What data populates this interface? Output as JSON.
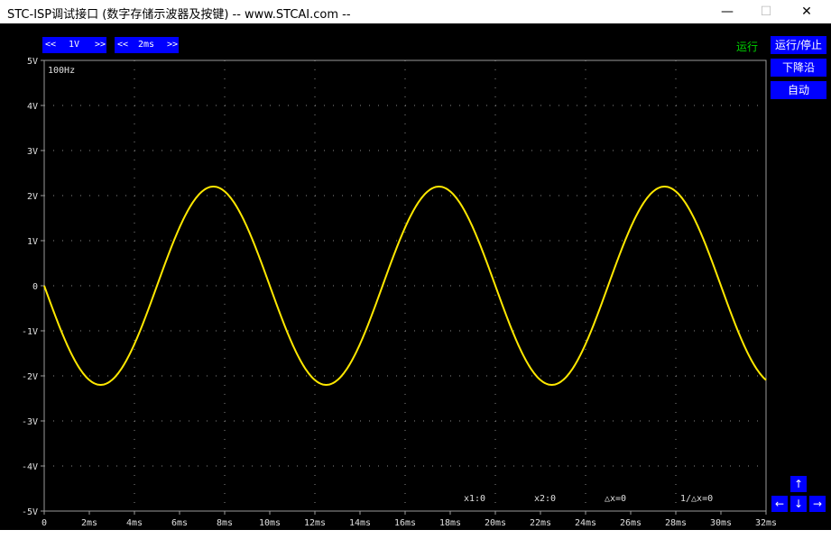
{
  "window": {
    "title": "STC-ISP调试接口 (数字存储示波器及按键) -- www.STCAI.com --",
    "minimize_icon": "—",
    "maximize_icon": "☐",
    "close_icon": "✕"
  },
  "toolbar": {
    "volt_prev": "<<",
    "volt_value": "1V",
    "volt_next": ">>",
    "time_prev": "<<",
    "time_value": "2ms",
    "time_next": ">>"
  },
  "status_text": "运行",
  "side_buttons": {
    "run_stop": "运行/停止",
    "trigger_edge": "下降沿",
    "auto": "自动"
  },
  "arrows": {
    "up": "↑",
    "down": "↓",
    "left": "←",
    "right": "→"
  },
  "frequency_label": "100Hz",
  "cursors": {
    "x1": "x1:0",
    "x2": "x2:0",
    "dx": "△x=0",
    "inv_dx": "1/△x=0"
  },
  "colors": {
    "trace": "#ffe800",
    "button_bg": "#0000ff",
    "status": "#00d400",
    "grid": "#8a8a8a",
    "frame": "#9a9a9a"
  },
  "chart_data": {
    "type": "line",
    "title": "",
    "xlabel": "",
    "ylabel": "",
    "xlim": [
      0,
      32
    ],
    "ylim": [
      -5,
      5
    ],
    "x_unit": "ms",
    "y_unit": "V",
    "xticks": [
      "0",
      "2ms",
      "4ms",
      "6ms",
      "8ms",
      "10ms",
      "12ms",
      "14ms",
      "16ms",
      "18ms",
      "20ms",
      "22ms",
      "24ms",
      "26ms",
      "28ms",
      "30ms",
      "32ms"
    ],
    "yticks": [
      "5V",
      "4V",
      "3V",
      "2V",
      "1V",
      "0",
      "-1V",
      "-2V",
      "-3V",
      "-4V",
      "-5V"
    ],
    "grid": true,
    "series": [
      {
        "waveform": "sine",
        "frequency_hz": 100,
        "amplitude_v": 2.2,
        "phase": "starts at 0 V falling at 0 ms",
        "x": [
          0,
          2.5,
          5,
          7.5,
          10,
          12.5,
          15,
          17.5,
          20,
          22.5,
          25,
          27.5,
          30,
          32
        ],
        "y": [
          0,
          -2.2,
          0,
          2.2,
          0,
          -2.2,
          0,
          2.2,
          0,
          -2.2,
          0,
          2.2,
          0,
          -2.1
        ]
      }
    ]
  }
}
